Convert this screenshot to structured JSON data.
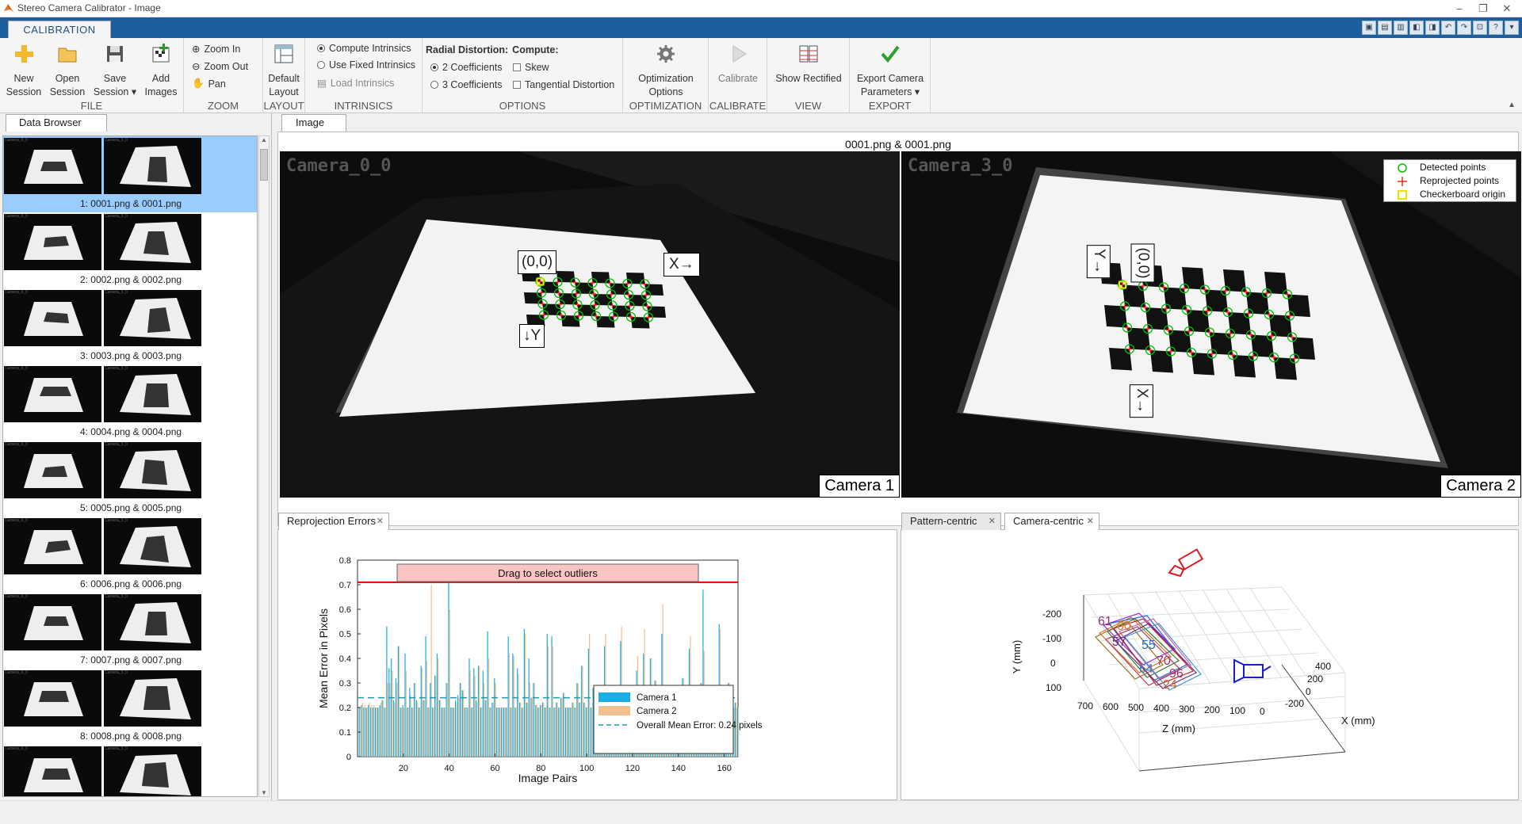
{
  "window": {
    "title": "Stereo Camera Calibrator - Image",
    "controls": [
      "–",
      "❐",
      "✕"
    ]
  },
  "toolstrip": {
    "tab": "CALIBRATION",
    "qat": [
      "▣",
      "▤",
      "▥",
      "◧",
      "◨",
      "↶",
      "↷",
      "⊡",
      "?",
      "▾"
    ]
  },
  "ribbon": {
    "file": {
      "label": "FILE",
      "new_session": [
        "New",
        "Session"
      ],
      "open_session": [
        "Open",
        "Session"
      ],
      "save_session": [
        "Save",
        "Session ▾"
      ],
      "add_images": [
        "Add",
        "Images"
      ]
    },
    "zoom": {
      "label": "ZOOM",
      "zoom_in": "Zoom In",
      "zoom_out": "Zoom Out",
      "pan": "Pan"
    },
    "layout": {
      "label": "LAYOUT",
      "default_layout": [
        "Default",
        "Layout"
      ]
    },
    "intrinsics": {
      "label": "INTRINSICS",
      "compute": "Compute Intrinsics",
      "fixed": "Use Fixed Intrinsics",
      "load": "Load Intrinsics"
    },
    "options": {
      "label": "OPTIONS",
      "radial_title": "Radial Distortion:",
      "compute_title": "Compute:",
      "two_coeff": "2 Coefficients",
      "three_coeff": "3 Coefficients",
      "skew": "Skew",
      "tangential": "Tangential Distortion"
    },
    "optimization": {
      "label": "OPTIMIZATION",
      "button": [
        "Optimization",
        "Options"
      ]
    },
    "calibrate": {
      "label": "CALIBRATE",
      "button": "Calibrate"
    },
    "view": {
      "label": "VIEW",
      "button": "Show Rectified"
    },
    "export": {
      "label": "EXPORT",
      "button": [
        "Export Camera",
        "Parameters ▾"
      ]
    }
  },
  "data_browser": {
    "tab": "Data Browser",
    "thumb_caption_left": "Camera_0_0",
    "thumb_caption_right": "Camera_3_0",
    "items": [
      "1: 0001.png & 0001.png",
      "2: 0002.png & 0002.png",
      "3: 0003.png & 0003.png",
      "4: 0004.png & 0004.png",
      "5: 0005.png & 0005.png",
      "6: 0006.png & 0006.png",
      "7: 0007.png & 0007.png",
      "8: 0008.png & 0008.png",
      ""
    ]
  },
  "image_view": {
    "tab": "Image",
    "title": "0001.png & 0001.png",
    "cam1": {
      "name": "Camera_0_0",
      "label": "Camera 1",
      "origin": "(0,0)",
      "xaxis": "X→",
      "yaxis": "↓Y"
    },
    "cam2": {
      "name": "Camera_3_0",
      "label": "Camera 2",
      "origin": "(0,0)",
      "xaxis": "X→",
      "yaxis": "Y→"
    },
    "legend": [
      "Detected points",
      "Reprojected points",
      "Checkerboard origin"
    ],
    "colors": {
      "detected": "#00c000",
      "reprojected": "#ff2020",
      "origin": "#f0e000"
    }
  },
  "reprojection": {
    "tab": "Reprojection Errors",
    "drag_label": "Drag to select outliers",
    "legend": [
      "Camera 1",
      "Camera 2",
      "Overall Mean Error: 0.24 pixels"
    ],
    "colors": {
      "camera1": "#1aaee6",
      "camera2": "#f0c090",
      "mean": "#1a9ab5",
      "threshold": "#e00000"
    }
  },
  "extrinsics": {
    "tabs": [
      "Pattern-centric",
      "Camera-centric"
    ],
    "ylabel": "Y (mm)",
    "xlabel": "X (mm)",
    "zlabel": "Z (mm)",
    "y_ticks": [
      "-200",
      "-100",
      "0",
      "100"
    ],
    "z_ticks": [
      "700",
      "600",
      "500",
      "400",
      "300",
      "200",
      "100",
      "0"
    ],
    "x_ticks": [
      "400",
      "200",
      "0",
      "-200"
    ],
    "pattern_numbers": [
      "61",
      "60",
      "57",
      "55",
      "70",
      "64",
      "96",
      "24"
    ]
  },
  "chart_data": {
    "type": "bar",
    "title": "",
    "xlabel": "Image Pairs",
    "ylabel": "Mean Error in Pixels",
    "xlim": [
      0,
      166
    ],
    "ylim": [
      0,
      0.8
    ],
    "xticks": [
      20,
      40,
      60,
      80,
      100,
      120,
      140,
      160
    ],
    "yticks": [
      0,
      0.1,
      0.2,
      0.3,
      0.4,
      0.5,
      0.6,
      0.7,
      0.8
    ],
    "mean_error": 0.24,
    "outlier_threshold": 0.71,
    "series": [
      {
        "name": "Camera 1",
        "values": [
          0.2,
          0.21,
          0.2,
          0.2,
          0.21,
          0.2,
          0.2,
          0.2,
          0.2,
          0.21,
          0.23,
          0.2,
          0.53,
          0.36,
          0.4,
          0.23,
          0.32,
          0.45,
          0.2,
          0.21,
          0.42,
          0.2,
          0.28,
          0.2,
          0.3,
          0.23,
          0.2,
          0.37,
          0.23,
          0.49,
          0.2,
          0.3,
          0.2,
          0.33,
          0.42,
          0.23,
          0.2,
          0.2,
          0.3,
          0.71,
          0.2,
          0.2,
          0.23,
          0.25,
          0.3,
          0.27,
          0.2,
          0.2,
          0.4,
          0.2,
          0.36,
          0.23,
          0.37,
          0.2,
          0.35,
          0.23,
          0.51,
          0.2,
          0.22,
          0.32,
          0.2,
          0.2,
          0.2,
          0.2,
          0.2,
          0.49,
          0.2,
          0.42,
          0.2,
          0.36,
          0.22,
          0.2,
          0.52,
          0.22,
          0.4,
          0.24,
          0.3,
          0.21,
          0.2,
          0.21,
          0.22,
          0.2,
          0.5,
          0.2,
          0.49,
          0.2,
          0.22,
          0.2,
          0.24,
          0.26,
          0.2,
          0.2,
          0.2,
          0.22,
          0.2,
          0.3,
          0.22,
          0.37,
          0.22,
          0.2,
          0.44,
          0.2,
          0.28,
          0.2,
          0.26,
          0.2,
          0.2,
          0.45,
          0.2,
          0.22,
          0.26,
          0.2,
          0.2,
          0.24,
          0.47,
          0.2,
          0.26,
          0.2,
          0.2,
          0.24,
          0.2,
          0.35,
          0.22,
          0.2,
          0.42,
          0.2,
          0.23,
          0.4,
          0.2,
          0.31,
          0.2,
          0.22,
          0.5,
          0.2,
          0.2,
          0.23,
          0.2,
          0.2,
          0.26,
          0.2,
          0.22,
          0.32,
          0.2,
          0.2,
          0.44,
          0.2,
          0.22,
          0.2,
          0.2,
          0.3,
          0.68,
          0.2,
          0.22,
          0.2,
          0.25,
          0.2,
          0.2,
          0.54,
          0.2,
          0.22,
          0.2,
          0.3,
          0.2,
          0.2,
          0.22,
          0.2
        ]
      },
      {
        "name": "Camera 2",
        "values": [
          0.2,
          0.22,
          0.21,
          0.2,
          0.22,
          0.21,
          0.21,
          0.2,
          0.2,
          0.22,
          0.23,
          0.2,
          0.3,
          0.3,
          0.35,
          0.22,
          0.3,
          0.45,
          0.2,
          0.2,
          0.35,
          0.2,
          0.25,
          0.2,
          0.3,
          0.22,
          0.2,
          0.36,
          0.23,
          0.39,
          0.2,
          0.7,
          0.2,
          0.33,
          0.4,
          0.23,
          0.2,
          0.2,
          0.3,
          0.6,
          0.2,
          0.2,
          0.22,
          0.24,
          0.3,
          0.27,
          0.2,
          0.2,
          0.35,
          0.2,
          0.33,
          0.22,
          0.37,
          0.2,
          0.3,
          0.23,
          0.4,
          0.2,
          0.22,
          0.3,
          0.2,
          0.2,
          0.2,
          0.2,
          0.2,
          0.42,
          0.2,
          0.41,
          0.2,
          0.34,
          0.22,
          0.2,
          0.5,
          0.22,
          0.3,
          0.24,
          0.3,
          0.21,
          0.2,
          0.21,
          0.22,
          0.2,
          0.45,
          0.2,
          0.45,
          0.2,
          0.22,
          0.2,
          0.24,
          0.26,
          0.2,
          0.2,
          0.2,
          0.22,
          0.2,
          0.3,
          0.22,
          0.37,
          0.22,
          0.2,
          0.5,
          0.2,
          0.28,
          0.2,
          0.26,
          0.2,
          0.2,
          0.5,
          0.2,
          0.22,
          0.26,
          0.2,
          0.2,
          0.24,
          0.53,
          0.2,
          0.26,
          0.2,
          0.2,
          0.24,
          0.2,
          0.41,
          0.22,
          0.2,
          0.52,
          0.2,
          0.23,
          0.4,
          0.2,
          0.31,
          0.2,
          0.22,
          0.62,
          0.2,
          0.2,
          0.23,
          0.2,
          0.2,
          0.26,
          0.2,
          0.22,
          0.32,
          0.2,
          0.2,
          0.49,
          0.2,
          0.22,
          0.2,
          0.2,
          0.3,
          0.43,
          0.2,
          0.22,
          0.2,
          0.25,
          0.2,
          0.2,
          0.52,
          0.2,
          0.22,
          0.2,
          0.3,
          0.2,
          0.2,
          0.22,
          0.2
        ]
      }
    ]
  }
}
